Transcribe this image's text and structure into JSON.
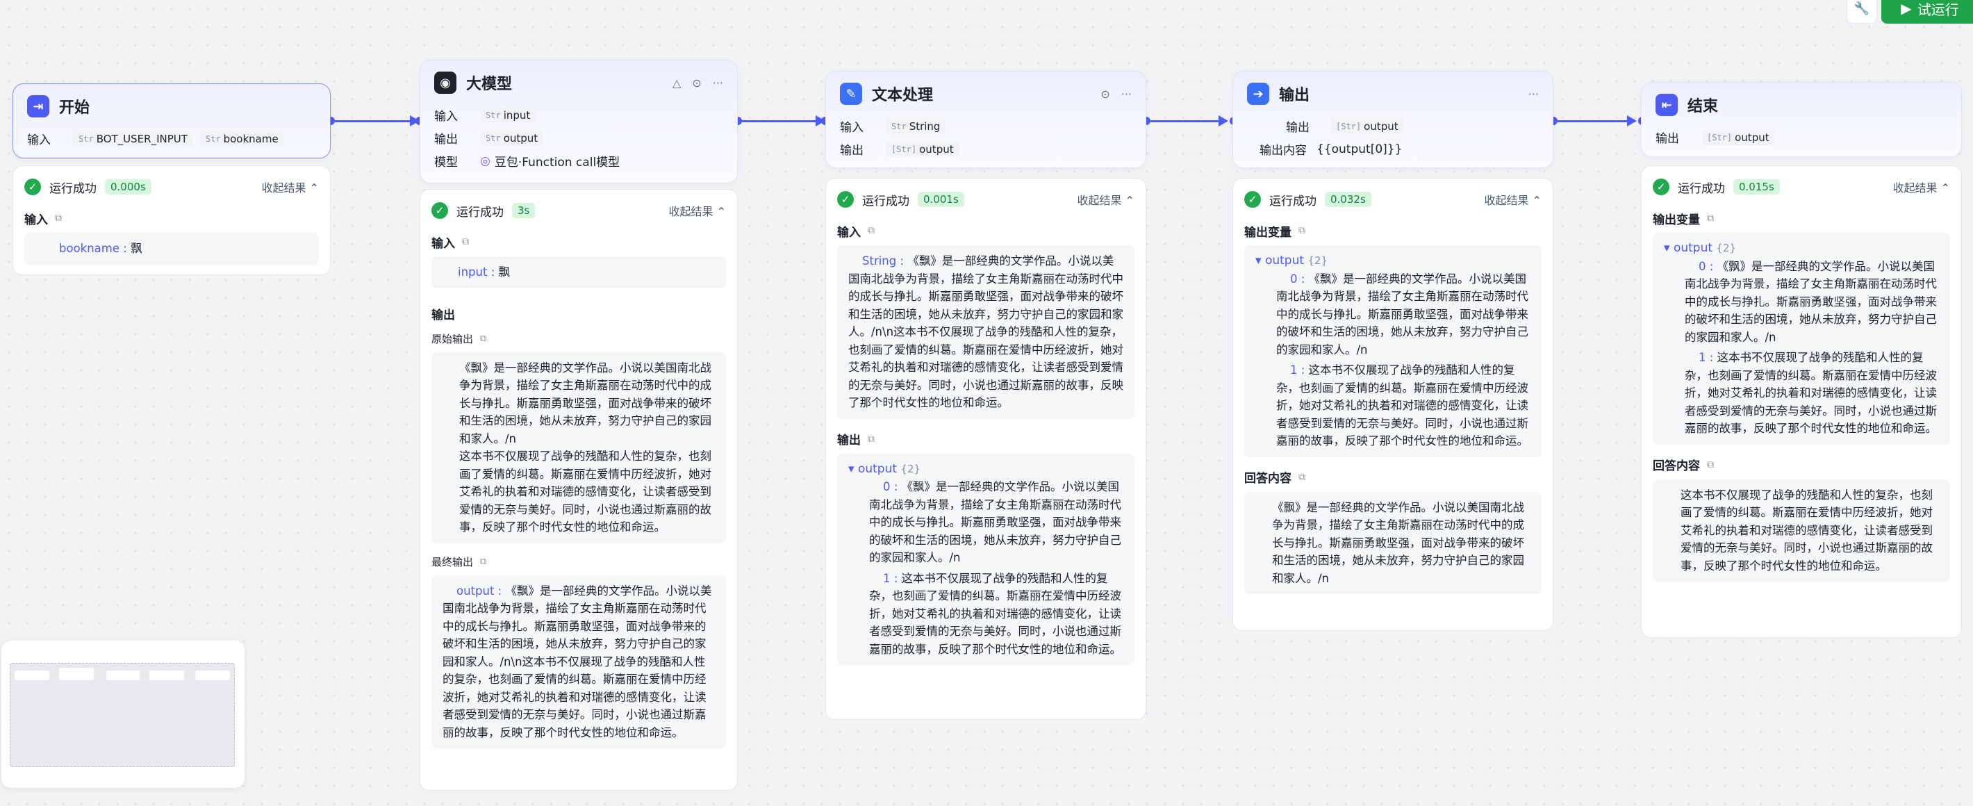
{
  "toolbar": {
    "run_label": "试运行",
    "tool_icon": "debug-icon"
  },
  "colors": {
    "accent": "#4e5bf2",
    "success": "#22a950",
    "run": "#1fa34a"
  },
  "common": {
    "run_success": "运行成功",
    "collapse": "收起结果"
  },
  "start": {
    "title": "开始",
    "input_label": "输入",
    "inputs": [
      {
        "type": "Str",
        "name": "BOT_USER_INPUT"
      },
      {
        "type": "Str",
        "name": "bookname"
      }
    ],
    "result": {
      "time": "0.000s",
      "input_label": "输入",
      "key": "bookname",
      "value": "飘"
    }
  },
  "llm": {
    "title": "大模型",
    "input_label": "输入",
    "input_type": "Str",
    "input_name": "input",
    "output_label": "输出",
    "output_type": "Str",
    "output_name": "output",
    "model_label": "模型",
    "model_name": "豆包·Function call模型",
    "result": {
      "time": "3s",
      "input_label": "输入",
      "input_key": "input",
      "input_value": "飘",
      "output_label": "输出",
      "raw_label": "原始输出",
      "raw_text_1": "《飘》是一部经典的文学作品。小说以美国南北战争为背景，描绘了女主角斯嘉丽在动荡时代中的成长与挣扎。斯嘉丽勇敢坚强，面对战争带来的破坏和生活的困境，她从未放弃，努力守护自己的家园和家人。/n",
      "raw_text_2": "这本书不仅展现了战争的残酷和人性的复杂，也刻画了爱情的纠葛。斯嘉丽在爱情中历经波折，她对艾希礼的执着和对瑞德的感情变化，让读者感受到爱情的无奈与美好。同时，小说也通过斯嘉丽的故事，反映了那个时代女性的地位和命运。",
      "final_label": "最终输出",
      "final_key": "output",
      "final_text": "《飘》是一部经典的文学作品。小说以美国南北战争为背景，描绘了女主角斯嘉丽在动荡时代中的成长与挣扎。斯嘉丽勇敢坚强，面对战争带来的破坏和生活的困境，她从未放弃，努力守护自己的家园和家人。/n\\n这本书不仅展现了战争的残酷和人性的复杂，也刻画了爱情的纠葛。斯嘉丽在爱情中历经波折，她对艾希礼的执着和对瑞德的感情变化，让读者感受到爱情的无奈与美好。同时，小说也通过斯嘉丽的故事，反映了那个时代女性的地位和命运。"
    }
  },
  "text": {
    "title": "文本处理",
    "input_label": "输入",
    "input_type": "Str",
    "input_name": "String",
    "output_label": "输出",
    "output_type": "[Str]",
    "output_name": "output",
    "result": {
      "time": "0.001s",
      "input_label": "输入",
      "input_key": "String",
      "input_text": "《飘》是一部经典的文学作品。小说以美国南北战争为背景，描绘了女主角斯嘉丽在动荡时代中的成长与挣扎。斯嘉丽勇敢坚强，面对战争带来的破坏和生活的困境，她从未放弃，努力守护自己的家园和家人。/n\\n这本书不仅展现了战争的残酷和人性的复杂，也刻画了爱情的纠葛。斯嘉丽在爱情中历经波折，她对艾希礼的执着和对瑞德的感情变化，让读者感受到爱情的无奈与美好。同时，小说也通过斯嘉丽的故事，反映了那个时代女性的地位和命运。",
      "output_label": "输出",
      "tree_key": "output",
      "tree_count": "{2}",
      "item0": "《飘》是一部经典的文学作品。小说以美国南北战争为背景，描绘了女主角斯嘉丽在动荡时代中的成长与挣扎。斯嘉丽勇敢坚强，面对战争带来的破坏和生活的困境，她从未放弃，努力守护自己的家园和家人。/n",
      "item1": "这本书不仅展现了战争的残酷和人性的复杂，也刻画了爱情的纠葛。斯嘉丽在爱情中历经波折，她对艾希礼的执着和对瑞德的感情变化，让读者感受到爱情的无奈与美好。同时，小说也通过斯嘉丽的故事，反映了那个时代女性的地位和命运。"
    }
  },
  "output": {
    "title": "输出",
    "output_label": "输出",
    "output_type": "[Str]",
    "output_name": "output",
    "content_label": "输出内容",
    "content_value": "{{output[0]}}",
    "result": {
      "time": "0.032s",
      "vars_label": "输出变量",
      "tree_key": "output",
      "tree_count": "{2}",
      "item0": "《飘》是一部经典的文学作品。小说以美国南北战争为背景，描绘了女主角斯嘉丽在动荡时代中的成长与挣扎。斯嘉丽勇敢坚强，面对战争带来的破坏和生活的困境，她从未放弃，努力守护自己的家园和家人。/n",
      "item1": "这本书不仅展现了战争的残酷和人性的复杂，也刻画了爱情的纠葛。斯嘉丽在爱情中历经波折，她对艾希礼的执着和对瑞德的感情变化，让读者感受到爱情的无奈与美好。同时，小说也通过斯嘉丽的故事，反映了那个时代女性的地位和命运。",
      "answer_label": "回答内容",
      "answer_text": "《飘》是一部经典的文学作品。小说以美国南北战争为背景，描绘了女主角斯嘉丽在动荡时代中的成长与挣扎。斯嘉丽勇敢坚强，面对战争带来的破坏和生活的困境，她从未放弃，努力守护自己的家园和家人。/n"
    }
  },
  "end": {
    "title": "结束",
    "output_label": "输出",
    "output_type": "[Str]",
    "output_name": "output",
    "result": {
      "time": "0.015s",
      "vars_label": "输出变量",
      "tree_key": "output",
      "tree_count": "{2}",
      "item0": "《飘》是一部经典的文学作品。小说以美国南北战争为背景，描绘了女主角斯嘉丽在动荡时代中的成长与挣扎。斯嘉丽勇敢坚强，面对战争带来的破坏和生活的困境，她从未放弃，努力守护自己的家园和家人。/n",
      "item1": "这本书不仅展现了战争的残酷和人性的复杂，也刻画了爱情的纠葛。斯嘉丽在爱情中历经波折，她对艾希礼的执着和对瑞德的感情变化，让读者感受到爱情的无奈与美好。同时，小说也通过斯嘉丽的故事，反映了那个时代女性的地位和命运。",
      "answer_label": "回答内容",
      "answer_text": "这本书不仅展现了战争的残酷和人性的复杂，也刻画了爱情的纠葛。斯嘉丽在爱情中历经波折，她对艾希礼的执着和对瑞德的感情变化，让读者感受到爱情的无奈与美好。同时，小说也通过斯嘉丽的故事，反映了那个时代女性的地位和命运。"
    }
  }
}
